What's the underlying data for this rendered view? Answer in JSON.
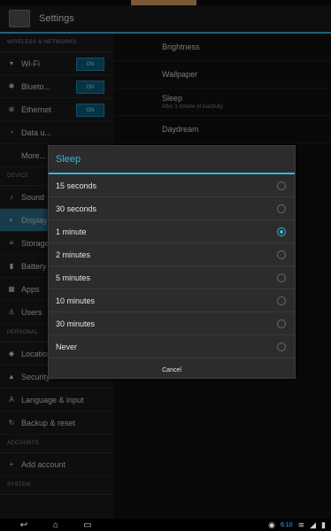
{
  "app": {
    "title": "Settings"
  },
  "left": {
    "sections": [
      {
        "header": "WIRELESS & NETWORKS",
        "items": [
          {
            "label": "Wi-Fi",
            "icon": "wifi-icon",
            "toggle": "ON"
          },
          {
            "label": "Blueto...",
            "icon": "bluetooth-icon",
            "toggle": "ON"
          },
          {
            "label": "Ethernet",
            "icon": "ethernet-icon",
            "toggle": "ON"
          },
          {
            "label": "Data u...",
            "icon": "data-usage-icon"
          },
          {
            "label": "More...",
            "icon": ""
          }
        ]
      },
      {
        "header": "DEVICE",
        "items": [
          {
            "label": "Sound",
            "icon": "sound-icon"
          },
          {
            "label": "Display",
            "icon": "display-icon",
            "selected": true
          },
          {
            "label": "Storage",
            "icon": "storage-icon"
          },
          {
            "label": "Battery",
            "icon": "battery-icon"
          },
          {
            "label": "Apps",
            "icon": "apps-icon"
          },
          {
            "label": "Users",
            "icon": "users-icon"
          }
        ]
      },
      {
        "header": "PERSONAL",
        "items": [
          {
            "label": "Location",
            "icon": "location-icon"
          },
          {
            "label": "Security",
            "icon": "security-icon"
          },
          {
            "label": "Language & input",
            "icon": "language-icon"
          },
          {
            "label": "Backup & reset",
            "icon": "backup-icon"
          }
        ]
      },
      {
        "header": "ACCOUNTS",
        "items": [
          {
            "label": "Add account",
            "icon": "add-icon"
          }
        ]
      },
      {
        "header": "SYSTEM",
        "items": []
      }
    ]
  },
  "right": {
    "items": [
      {
        "title": "Brightness",
        "subtitle": ""
      },
      {
        "title": "Wallpaper",
        "subtitle": ""
      },
      {
        "title": "Sleep",
        "subtitle": "After 1 minute of inactivity"
      },
      {
        "title": "Daydream",
        "subtitle": ""
      }
    ]
  },
  "dialog": {
    "title": "Sleep",
    "options": [
      {
        "label": "15 seconds",
        "checked": false
      },
      {
        "label": "30 seconds",
        "checked": false
      },
      {
        "label": "1 minute",
        "checked": true
      },
      {
        "label": "2 minutes",
        "checked": false
      },
      {
        "label": "5 minutes",
        "checked": false
      },
      {
        "label": "10 minutes",
        "checked": false
      },
      {
        "label": "30 minutes",
        "checked": false
      },
      {
        "label": "Never",
        "checked": false
      }
    ],
    "cancel": "Cancel"
  },
  "statusbar": {
    "time": "6:10"
  }
}
